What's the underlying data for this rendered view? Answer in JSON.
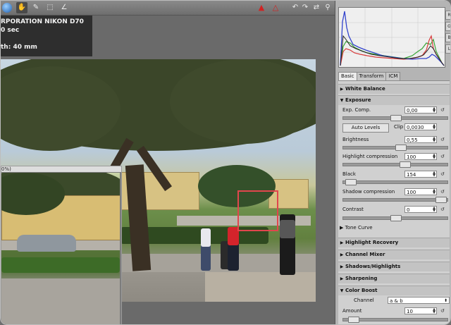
{
  "toolbar": {
    "left_tools": [
      "globe-icon",
      "hand-icon",
      "eyedropper-icon",
      "crop-icon",
      "straighten-icon"
    ],
    "right_warnings": [
      "warning-icon",
      "warning-outline-icon"
    ],
    "right_tools": [
      "rotate-left-icon",
      "rotate-right-icon",
      "flip-icon",
      "link-icon"
    ]
  },
  "exif": {
    "line1": "RPORATION NIKON D70",
    "line2": "0 sec",
    "line3": "th: 40 mm"
  },
  "navigator": {
    "title": "0%)"
  },
  "histogram": {
    "channel_tabs": [
      "R",
      "G",
      "B",
      "L"
    ],
    "colors": {
      "red": "#d83a3a",
      "green": "#3aa63a",
      "blue": "#3344cc",
      "luminance": "#222222"
    }
  },
  "panel": {
    "tabs": [
      "Basic",
      "Transform",
      "ICM"
    ],
    "selected_tab": "Basic",
    "white_balance": {
      "title": "White Balance"
    },
    "exposure": {
      "title": "Exposure",
      "exp_comp": {
        "label": "Exp. Comp.",
        "value": "0,00",
        "level": 0.5
      },
      "auto_levels": "Auto Levels",
      "clip": {
        "label": "Clip",
        "value": "0,0030"
      },
      "brightness": {
        "label": "Brightness",
        "value": "0,55",
        "level": 0.55
      },
      "highlight_compression": {
        "label": "Highlight compression",
        "value": "100",
        "level": 0.6
      },
      "black": {
        "label": "Black",
        "value": "154",
        "level": 0.02
      },
      "shadow_compression": {
        "label": "Shadow compression",
        "value": "100",
        "level": 0.98
      },
      "contrast": {
        "label": "Contrast",
        "value": "0",
        "level": 0.5
      },
      "tone_curve": "Tone Curve"
    },
    "sections": [
      "Highlight Recovery",
      "Channel Mixer",
      "Shadows/Highlights",
      "Sharpening"
    ],
    "color_boost": {
      "title": "Color Boost",
      "channel_label": "Channel",
      "channel_value": "a & b",
      "amount_label": "Amount",
      "amount_value": "10",
      "amount_level": 0.05
    }
  }
}
